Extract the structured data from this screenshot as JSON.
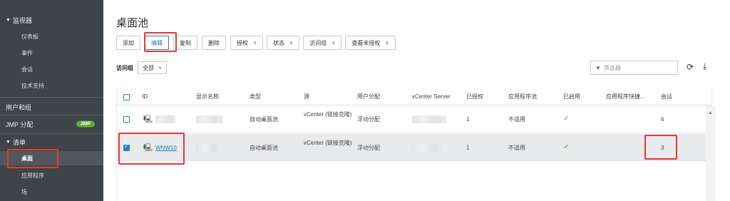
{
  "sidebar": {
    "monitor": {
      "label": "监视器",
      "items": [
        "仪表板",
        "事件",
        "会话",
        "技术支持"
      ]
    },
    "users_groups": "用户和组",
    "jmp": {
      "label": "JMP 分配",
      "badge": "JMP"
    },
    "inventory": {
      "label": "清单",
      "items": [
        "桌面",
        "应用程序",
        "场"
      ]
    }
  },
  "page": {
    "title": "桌面池"
  },
  "toolbar": {
    "add": "添加",
    "edit": "编辑",
    "copy": "复制",
    "delete": "删除",
    "entitle": "授权",
    "status": "状态",
    "access_group": "访问组",
    "view_unentitled": "查看未授权"
  },
  "filter": {
    "label": "访问组",
    "value": "全部",
    "search_placeholder": "筛选器"
  },
  "table": {
    "headers": [
      "ID",
      "显示名称",
      "类型",
      "源",
      "用户分配",
      "vCenter Server",
      "已授权",
      "应用程序池",
      "已启用",
      "应用程序快捷...",
      "会话"
    ],
    "rows": [
      {
        "id": "",
        "type": "自动桌面池",
        "source": "vCenter (链接克隆)",
        "assignment": "浮动分配",
        "entitled": "1",
        "app_pool": "不适用",
        "sessions": "6",
        "selected": false
      },
      {
        "id": "WNW10",
        "type": "自动桌面池",
        "source": "vCenter (链接克隆)",
        "assignment": "浮动分配",
        "entitled": "1",
        "app_pool": "不适用",
        "sessions": "3",
        "selected": true
      }
    ]
  },
  "colors": {
    "sidebar_bg": "#3f4449",
    "accent": "#1c7fc6",
    "highlight": "#e53935",
    "badge": "#5fae2f",
    "enabled_check": "#4aa02c"
  },
  "icons": {
    "monitor": "monitor-icon",
    "refresh": "refresh-icon",
    "download": "download-icon",
    "filter": "funnel-icon",
    "enabled": "check-icon"
  }
}
